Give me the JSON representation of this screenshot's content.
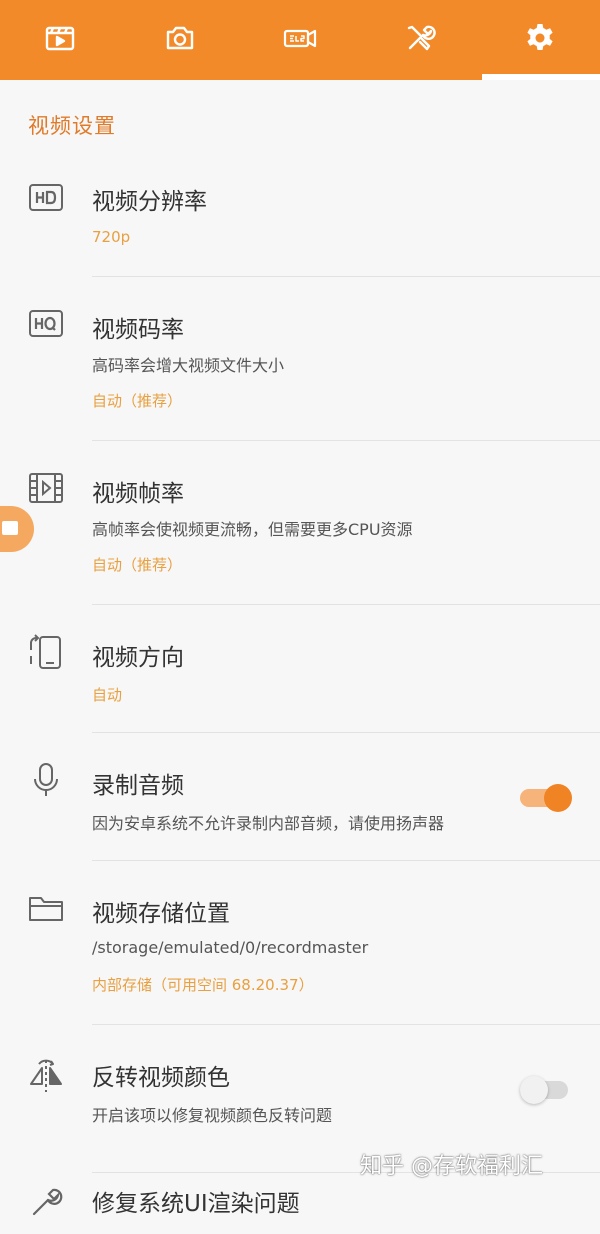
{
  "colors": {
    "accent": "#f38a2a",
    "value_text": "#e8a040",
    "section_title": "#e07b2a"
  },
  "tabs": [
    {
      "icon": "video-list-icon",
      "active": false
    },
    {
      "icon": "camera-icon",
      "active": false
    },
    {
      "icon": "video-edit-icon",
      "active": false
    },
    {
      "icon": "tools-icon",
      "active": false
    },
    {
      "icon": "gear-icon",
      "active": true
    }
  ],
  "section": {
    "title": "视频设置"
  },
  "settings": [
    {
      "icon": "hd-icon",
      "title": "视频分辨率",
      "value": "720p"
    },
    {
      "icon": "hq-icon",
      "title": "视频码率",
      "subtitle": "高码率会增大视频文件大小",
      "value": "自动（推荐）"
    },
    {
      "icon": "film-frame-icon",
      "title": "视频帧率",
      "subtitle": "高帧率会使视频更流畅，但需要更多CPU资源",
      "value": "自动（推荐）"
    },
    {
      "icon": "screen-rotate-icon",
      "title": "视频方向",
      "value": "自动"
    },
    {
      "icon": "microphone-icon",
      "title": "录制音频",
      "subtitle": "因为安卓系统不允许录制内部音频，请使用扬声器",
      "toggle": true
    },
    {
      "icon": "folder-icon",
      "title": "视频存储位置",
      "subtitle": "/storage/emulated/0/recordmaster",
      "value": "内部存储（可用空间 68.20.37）"
    },
    {
      "icon": "flip-color-icon",
      "title": "反转视频颜色",
      "subtitle": "开启该项以修复视频颜色反转问题",
      "toggle": false
    },
    {
      "icon": "wrench-icon",
      "title": "修复系统UI渲染问题"
    }
  ],
  "watermark": "知乎 @存软福利汇"
}
